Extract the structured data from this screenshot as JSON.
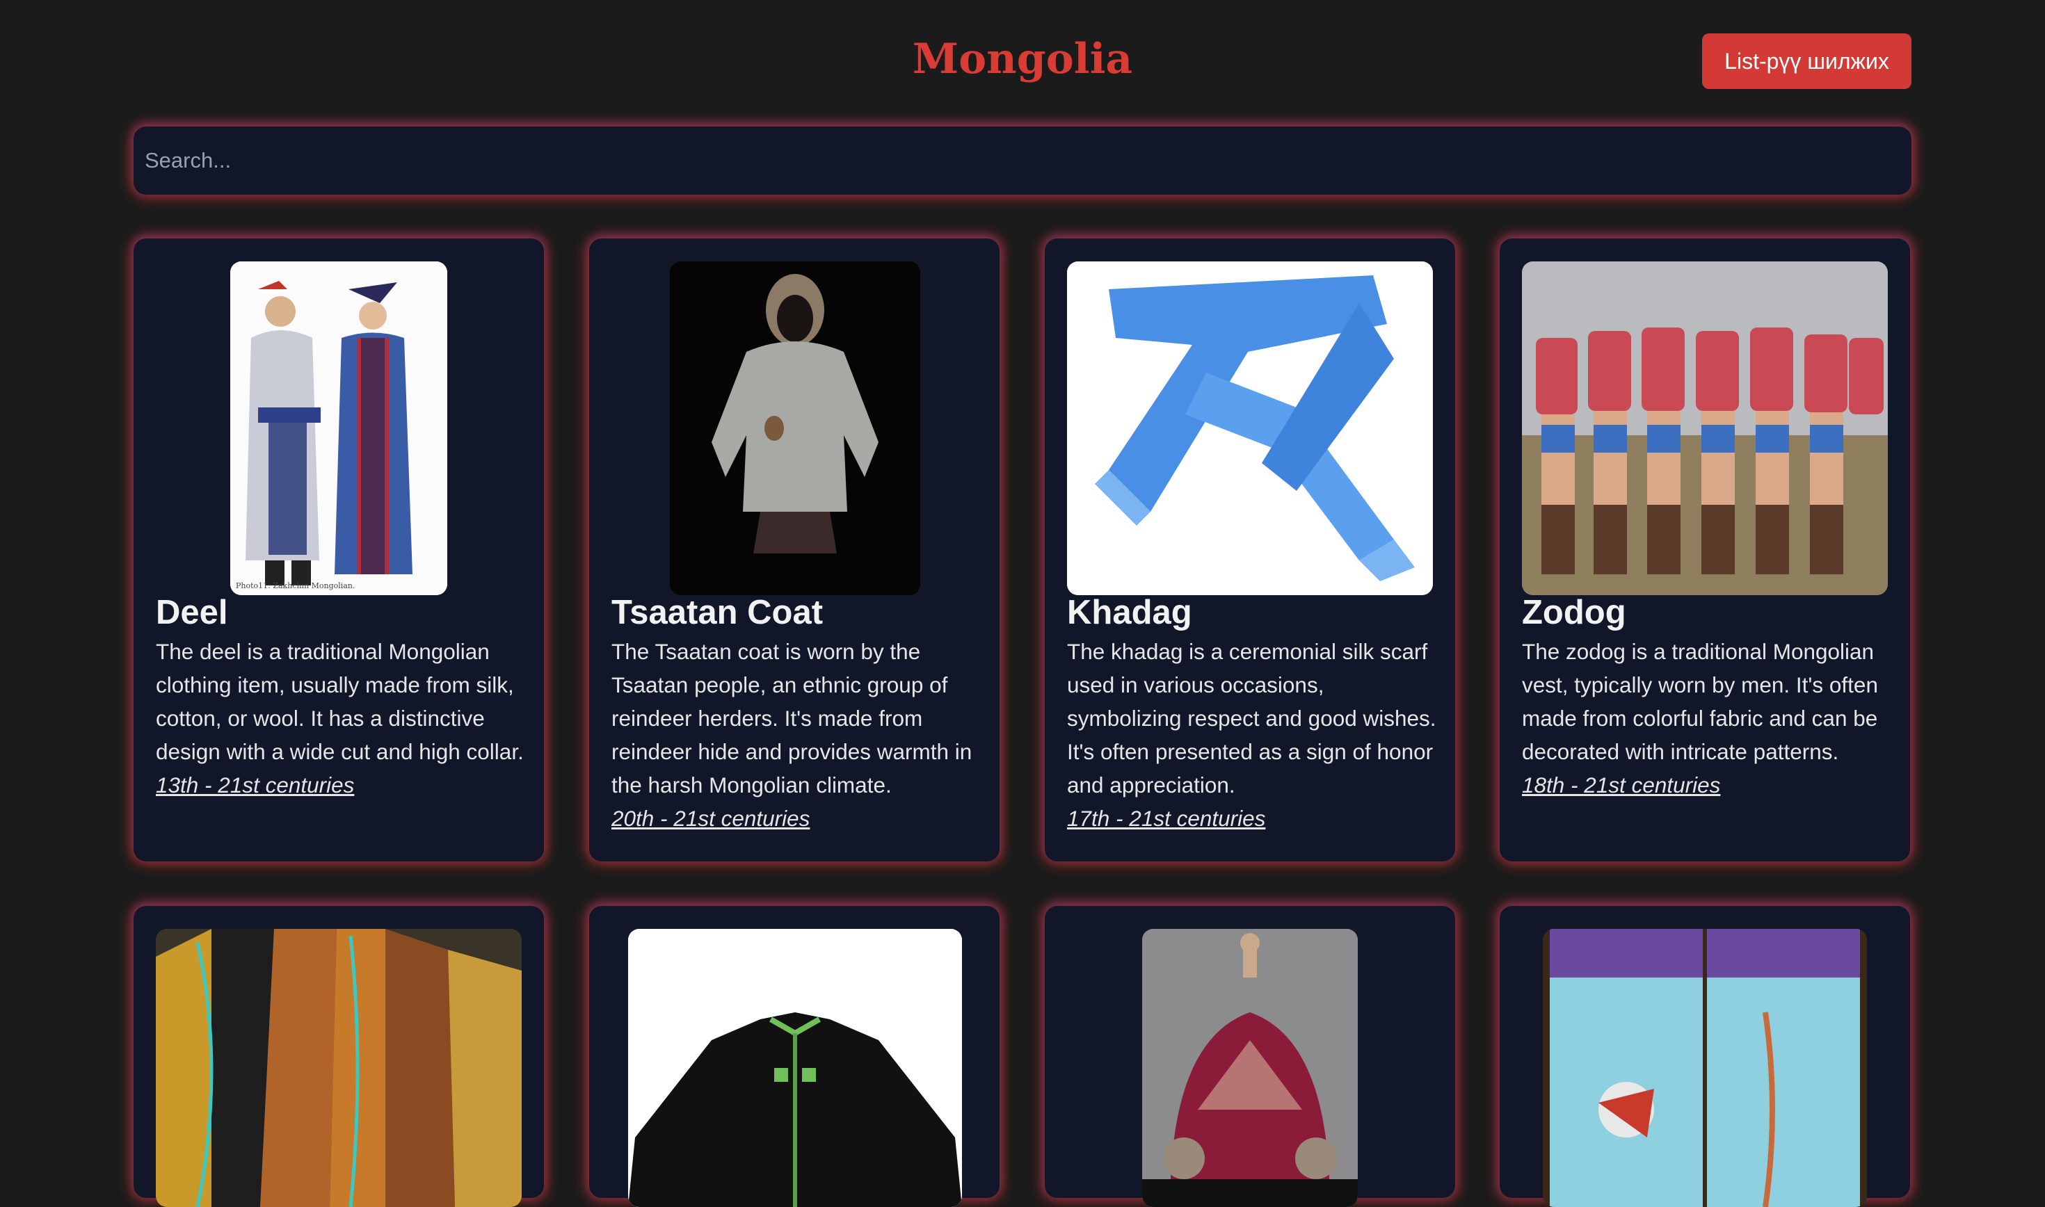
{
  "header": {
    "title": "Mongolia",
    "list_button_label": "List-рүү шилжих"
  },
  "search": {
    "placeholder": "Search...",
    "value": ""
  },
  "colors": {
    "accent": "#d93b35",
    "card_background": "#111629",
    "page_background": "#1b1b1b"
  },
  "cards": [
    {
      "title": "Deel",
      "description": "The deel is a traditional Mongolian clothing item, usually made from silk, cotton, or wool. It has a distinctive design with a wide cut and high collar.",
      "era": "13th - 21st centuries",
      "image_caption": "Photo11: Zakhchin Mongolian."
    },
    {
      "title": "Tsaatan Coat",
      "description": "The Tsaatan coat is worn by the Tsaatan people, an ethnic group of reindeer herders. It's made from reindeer hide and provides warmth in the harsh Mongolian climate.",
      "era": "20th - 21st centuries"
    },
    {
      "title": "Khadag",
      "description": "The khadag is a ceremonial silk scarf used in various occasions, symbolizing respect and good wishes. It's often presented as a sign of honor and appreciation.",
      "era": "17th - 21st centuries"
    },
    {
      "title": "Zodog",
      "description": "The zodog is a traditional Mongolian vest, typically worn by men. It's often made from colorful fabric and can be decorated with intricate patterns.",
      "era": "18th - 21st centuries"
    }
  ]
}
